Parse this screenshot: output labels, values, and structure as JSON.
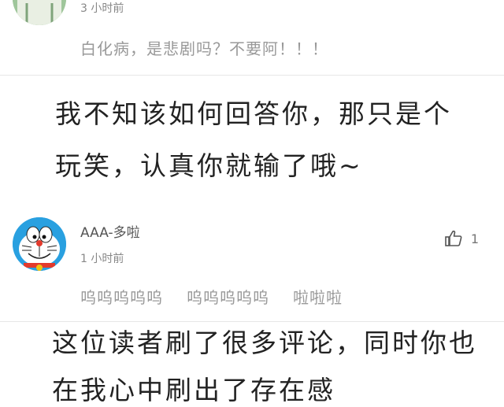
{
  "comment_1": {
    "timestamp": "3 小时前",
    "text": "白化病，是悲剧吗？不要阿！！！"
  },
  "caption_1": {
    "line1": "我不知该如何回答你，那只是个",
    "line2": "玩笑，认真你就输了哦~"
  },
  "comment_2": {
    "username": "AAA-多啦",
    "timestamp": "1 小时前",
    "like_count": "1",
    "text_parts": [
      "呜呜呜呜呜",
      "呜呜呜呜呜",
      "啦啦啦"
    ]
  },
  "caption_2": {
    "line1": "这位读者刷了很多评论，同时你也",
    "line2": "在我心中刷出了存在感"
  },
  "colors": {
    "caption_text": "#222222",
    "muted_text": "#999999",
    "avatar_doraemon": "#29a0e0"
  }
}
